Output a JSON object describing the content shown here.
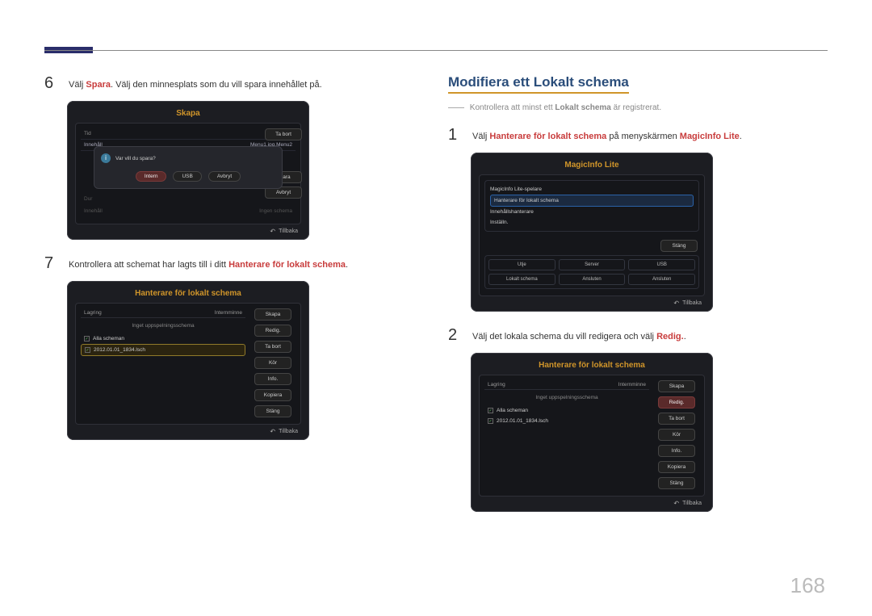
{
  "page_number": "168",
  "left": {
    "step6": {
      "num": "6",
      "pre": "Välj ",
      "spara": "Spara",
      "post": ". Välj den minnesplats som du vill spara innehållet på."
    },
    "skapa_device": {
      "title": "Skapa",
      "row_tid": "Tid",
      "row_innehall_label": "Innehåll",
      "row_innehall_value": "Menu1.jpg,Menu2",
      "dialog_question": "Var vill du spara?",
      "btn_intern": "Intern",
      "btn_usb": "USB",
      "btn_avbryt": "Avbryt",
      "btn_tabort": "Ta bort",
      "btn_spara": "Spara",
      "btn_side_avbryt": "Avbryt",
      "faded_dur": "Dur",
      "faded_innehall": "Innehåll",
      "faded_ingen": "Ingen schema",
      "back": "Tillbaka"
    },
    "step7": {
      "num": "7",
      "pre": "Kontrollera att schemat har lagts till i ditt ",
      "hant": "Hanterare för lokalt schema",
      "post": "."
    },
    "hant_device_left": {
      "title": "Hanterare för lokalt schema",
      "col_lagring": "Lagring",
      "col_internminne": "Internminne",
      "empty": "Inget uppspelningsschema",
      "alla": "Alla scheman",
      "file": "2012.01.01_1834.lsch",
      "btns": [
        "Skapa",
        "Redig.",
        "Ta bort",
        "Kör",
        "Info.",
        "Kopiera",
        "Stäng"
      ],
      "back": "Tillbaka"
    }
  },
  "right": {
    "heading": "Modifiera ett Lokalt schema",
    "note_pre": "Kontrollera att minst ett ",
    "note_bold": "Lokalt schema",
    "note_post": " är registrerat.",
    "step1": {
      "num": "1",
      "pre": "Välj ",
      "hant": "Hanterare för lokalt schema",
      "mid": " på menyskärmen ",
      "mi": "MagicInfo Lite",
      "post": "."
    },
    "minfo_device": {
      "title": "MagicInfo Lite",
      "menu_items": [
        "MagicInfo Lite-spelare",
        "Hanterare för lokalt schema",
        "Innehållshanterare",
        "Inställn."
      ],
      "btn_stang": "Stäng",
      "grid": [
        "Utje",
        "Server",
        "USB",
        "Lokalt schema",
        "Ansluten",
        "Ansluten"
      ],
      "back": "Tillbaka"
    },
    "step2": {
      "num": "2",
      "pre": "Välj det lokala schema du vill redigera och välj ",
      "redig": "Redig.",
      "post": "."
    },
    "hant_device_right": {
      "title": "Hanterare för lokalt schema",
      "col_lagring": "Lagring",
      "col_internminne": "Internminne",
      "empty": "Inget uppspelningsschema",
      "alla": "Alla scheman",
      "file": "2012.01.01_1834.lsch",
      "btns": [
        "Skapa",
        "Redig.",
        "Ta bort",
        "Kör",
        "Info.",
        "Kopiera",
        "Stäng"
      ],
      "back": "Tillbaka"
    }
  }
}
